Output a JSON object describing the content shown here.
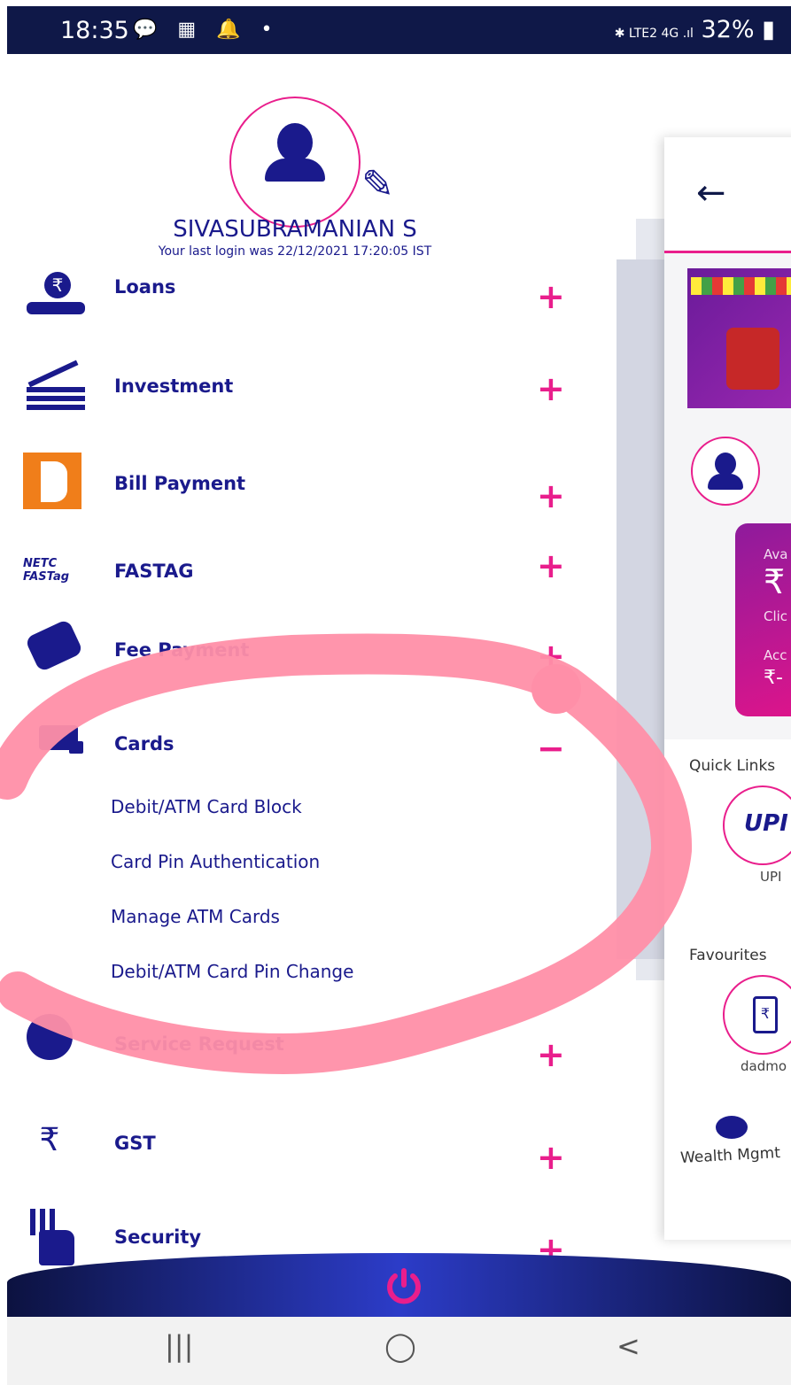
{
  "status_bar": {
    "time": "18:35",
    "icons": "💬 ▦ 🔔 •",
    "network": "✱ LTE2 4G .ıl",
    "battery": "32%"
  },
  "profile": {
    "name": "SIVASUBRAMANIAN S",
    "last_login": "Your last login was 22/12/2021 17:20:05 IST"
  },
  "menu": {
    "loans": "Loans",
    "investment": "Investment",
    "bill_payment": "Bill Payment",
    "fastag": "FASTAG",
    "fee_payment": "Fee Payment",
    "cards": "Cards",
    "service_request": "Service Request",
    "gst": "GST",
    "security": "Security",
    "expand": "+",
    "collapse": "−"
  },
  "cards_sub": [
    "Debit/ATM Card Block",
    "Card Pin Authentication",
    "Manage ATM Cards",
    "Debit/ATM Card Pin Change"
  ],
  "preview": {
    "back": "←",
    "card_lines": [
      "Ava",
      "₹",
      "Clic",
      "Acc",
      "₹-"
    ],
    "quick_links": "Quick Links",
    "upi_logo": "UPI",
    "upi": "UPI",
    "favourites": "Favourites",
    "fav_item": "dadmo",
    "wealth": "Wealth Mgmt"
  },
  "fastag_logo": "NETC FASTag",
  "navbar": {
    "recent": "|||",
    "home": "◯",
    "back": "<"
  },
  "colors": {
    "accent": "#e91e8c",
    "primary": "#1a1a8c",
    "status_bar": "#0f1848",
    "annotation": "#ff8fa8"
  }
}
